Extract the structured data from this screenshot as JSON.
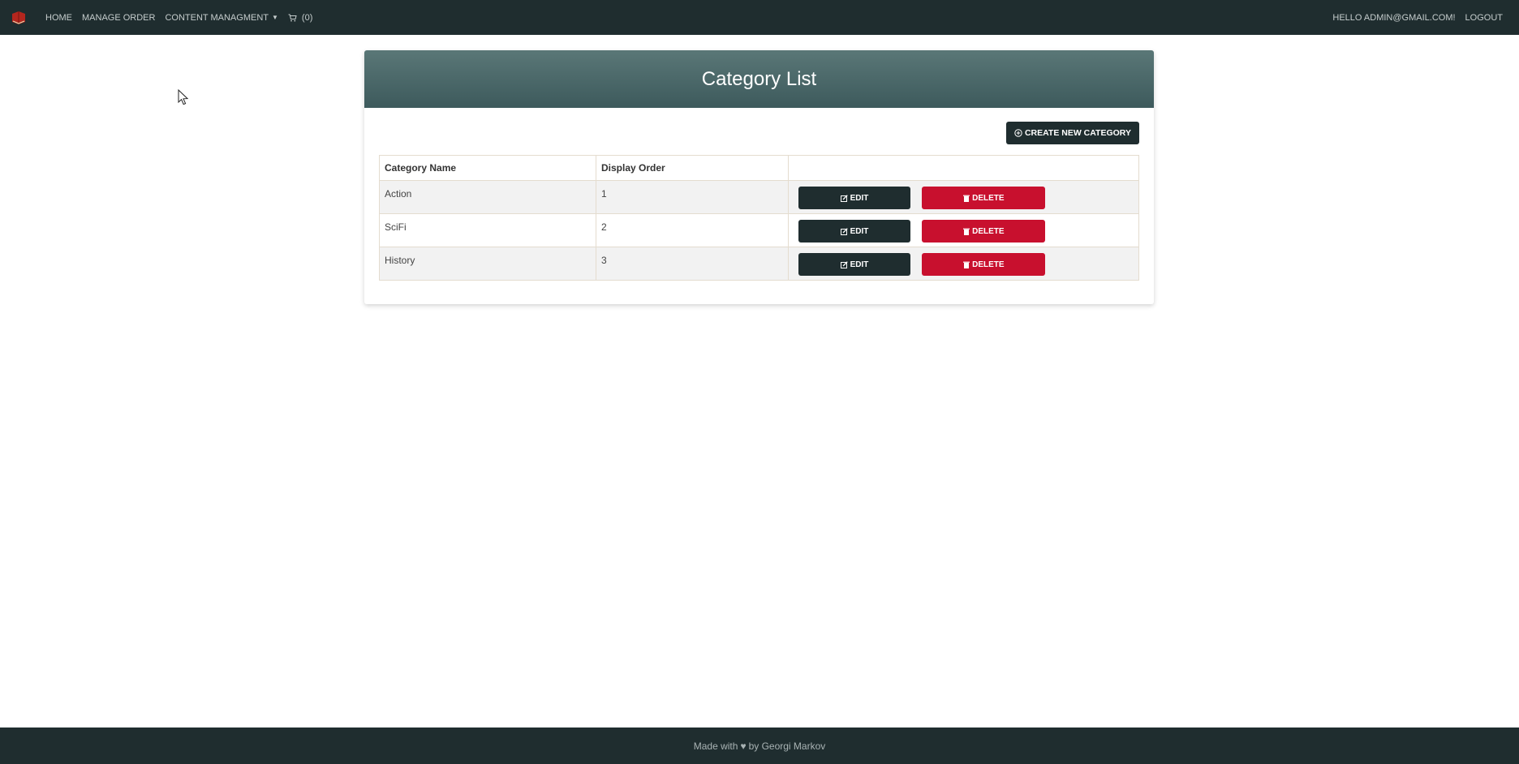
{
  "nav": {
    "home": "HOME",
    "manage_order": "MANAGE ORDER",
    "content_management": "CONTENT MANAGMENT",
    "cart_count": "(0)",
    "greeting": "HELLO ADMIN@GMAIL.COM!",
    "logout": "LOGOUT"
  },
  "page": {
    "title": "Category List",
    "create_button": "CREATE NEW CATEGORY"
  },
  "table": {
    "headers": [
      "Category Name",
      "Display Order",
      ""
    ],
    "rows": [
      {
        "name": "Action",
        "order": "1"
      },
      {
        "name": "SciFi",
        "order": "2"
      },
      {
        "name": "History",
        "order": "3"
      }
    ],
    "edit_label": "EDIT",
    "delete_label": "DELETE"
  },
  "footer": {
    "made_with": "Made with",
    "by": "by Georgi Markov"
  },
  "icons": {
    "brand": "book-logo-icon",
    "cart": "cart-icon",
    "create": "plus-circle-icon",
    "edit": "edit-icon",
    "delete": "trash-icon",
    "heart": "heart-icon"
  },
  "colors": {
    "navbar": "#1f2d2f",
    "header_gradient_top": "#5a7777",
    "header_gradient_bottom": "#3d5a5c",
    "danger": "#c8102e"
  }
}
